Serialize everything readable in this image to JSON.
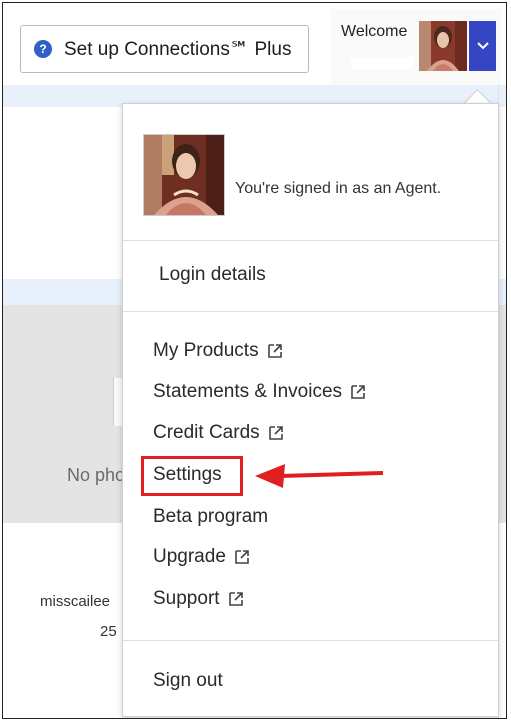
{
  "header": {
    "setup_button_label": "Set up Connections℠ Plus",
    "welcome_label": "Welcome"
  },
  "background": {
    "no_photo_text": "No pho",
    "name_text": "misscailee",
    "number_text": "25"
  },
  "dropdown": {
    "signed_in_text": "You're signed in as an Agent.",
    "login_details": "Login details",
    "items": [
      {
        "label": "My Products",
        "external": true
      },
      {
        "label": "Statements & Invoices",
        "external": true
      },
      {
        "label": "Credit Cards",
        "external": true
      },
      {
        "label": "Settings",
        "external": false
      },
      {
        "label": "Beta program",
        "external": false
      },
      {
        "label": "Upgrade",
        "external": true
      },
      {
        "label": "Support",
        "external": true
      }
    ],
    "sign_out": "Sign out"
  },
  "icons": {
    "help": "question-circle-icon",
    "chevron": "chevron-down-icon",
    "external": "external-link-icon",
    "annotation": "red-arrow-icon"
  },
  "colors": {
    "accent": "#3546c4",
    "help_icon": "#2f5fc7",
    "highlight": "#e02020",
    "strip": "#e7f0fb"
  }
}
